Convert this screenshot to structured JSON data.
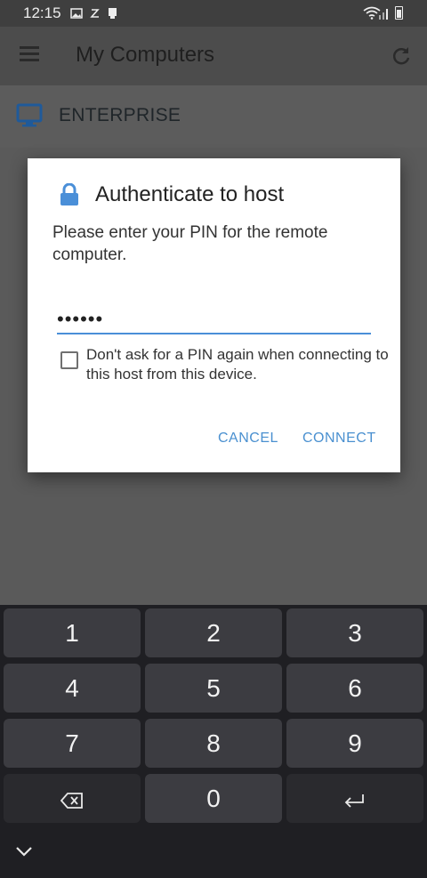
{
  "status_bar": {
    "time": "12:15"
  },
  "app_bar": {
    "title": "My Computers"
  },
  "host_list": {
    "items": [
      {
        "name": "ENTERPRISE"
      }
    ]
  },
  "dialog": {
    "title": "Authenticate to host",
    "message": "Please enter your PIN for the remote computer.",
    "pin_value": "••••••",
    "remember_label": "Don't ask for a PIN again when connecting to this host from this device.",
    "remember_checked": false,
    "cancel_label": "CANCEL",
    "connect_label": "CONNECT"
  },
  "keyboard": {
    "keys": [
      "1",
      "2",
      "3",
      "4",
      "5",
      "6",
      "7",
      "8",
      "9",
      "0"
    ]
  },
  "colors": {
    "accent": "#4a90d0",
    "scrim": "#5a5a5a",
    "keyboard_bg": "#1f1f23",
    "key_bg": "#3c3c41"
  },
  "icons": [
    "image-icon",
    "notification-icon",
    "app-icon",
    "wifi-icon",
    "signal-icon",
    "battery-icon",
    "menu-icon",
    "refresh-icon",
    "desktop-icon",
    "lock-icon",
    "backspace-icon",
    "enter-icon",
    "chevron-down-icon"
  ]
}
